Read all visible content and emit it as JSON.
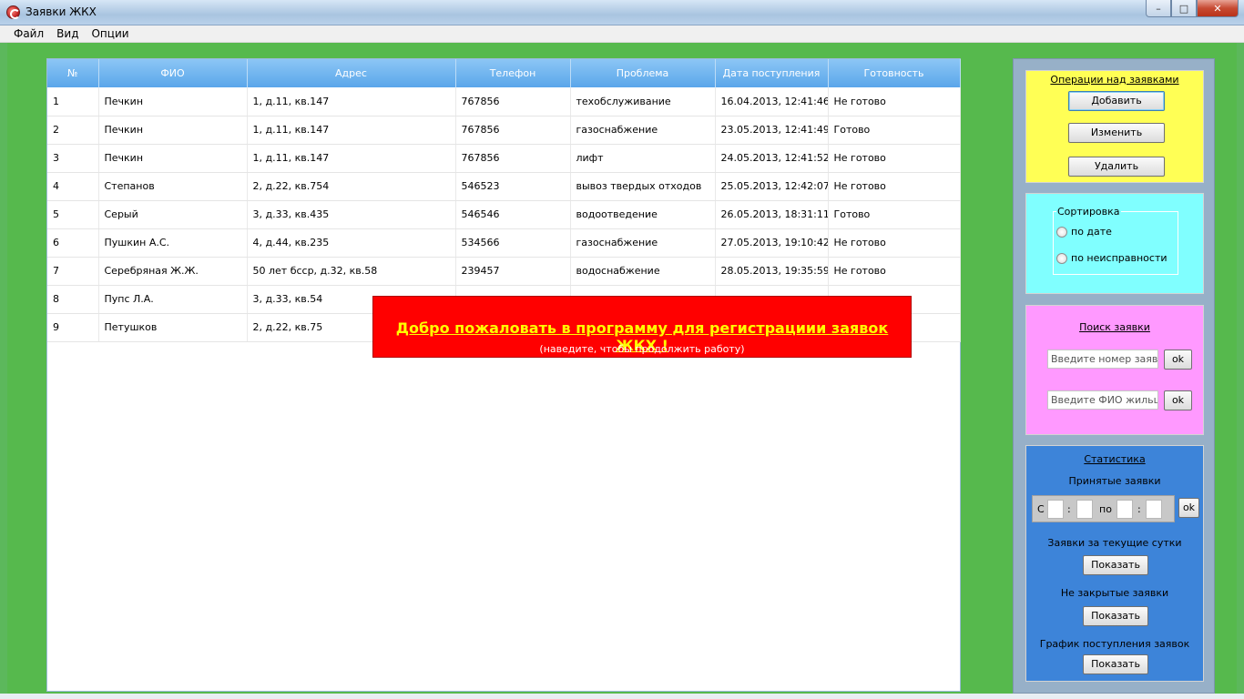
{
  "window": {
    "title": "Заявки ЖКХ",
    "controls": {
      "minimize": "–",
      "maximize": "□",
      "close": "✕"
    }
  },
  "menu": [
    "Файл",
    "Вид",
    "Опции"
  ],
  "table": {
    "columns": [
      "№",
      "ФИО",
      "Адрес",
      "Телефон",
      "Проблема",
      "Дата поступления",
      "Готовность"
    ],
    "rows": [
      [
        "1",
        "Печкин",
        "1, д.11, кв.147",
        "767856",
        "техобслуживание",
        "16.04.2013, 12:41:46",
        "Не готово"
      ],
      [
        "2",
        "Печкин",
        "1, д.11, кв.147",
        "767856",
        "газоснабжение",
        "23.05.2013, 12:41:49",
        "Готово"
      ],
      [
        "3",
        "Печкин",
        "1, д.11, кв.147",
        "767856",
        "лифт",
        "24.05.2013, 12:41:52",
        "Не готово"
      ],
      [
        "4",
        "Степанов",
        "2, д.22, кв.754",
        "546523",
        "вывоз твердых отходов",
        "25.05.2013, 12:42:07",
        "Не готово"
      ],
      [
        "5",
        "Серый",
        "3, д.33, кв.435",
        "546546",
        "водоотведение",
        "26.05.2013, 18:31:11",
        "Готово"
      ],
      [
        "6",
        "Пушкин А.С.",
        "4, д.44, кв.235",
        "534566",
        "газоснабжение",
        "27.05.2013, 19:10:42",
        "Не готово"
      ],
      [
        "7",
        "Серебряная Ж.Ж.",
        "50 лет бсср, д.32, кв.58",
        "239457",
        "водоснабжение",
        "28.05.2013, 19:35:59",
        "Не готово"
      ],
      [
        "8",
        "Пупс Л.А.",
        "3, д.33, кв.54",
        "",
        "",
        "",
        ""
      ],
      [
        "9",
        "Петушков",
        "2, д.22, кв.75",
        "",
        "",
        "",
        ""
      ]
    ]
  },
  "splash": {
    "title": "Добро пожаловать в программу для регистрациии заявок ЖКХ !",
    "subtitle": "(наведите, чтобы продолжить работу)"
  },
  "ops": {
    "title": "Операции над заявками",
    "add": "Добавить",
    "edit": "Изменить",
    "delete": "Удалить"
  },
  "sort": {
    "legend": "Сортировка",
    "by_date": "по дате",
    "by_fault": "по неисправности"
  },
  "search": {
    "title": "Поиск заявки",
    "number_placeholder": "Введите номер заявки",
    "name_placeholder": "Введите ФИО жильца",
    "ok": "ok"
  },
  "stats": {
    "title": "Статистика",
    "accepted": "Принятые заявки",
    "from": "С",
    "colon": ":",
    "to": "по",
    "ok": "ok",
    "today": "Заявки за текущие сутки",
    "not_closed": "Не закрытые заявки",
    "chart": "График поступления заявок",
    "show": "Показать"
  }
}
